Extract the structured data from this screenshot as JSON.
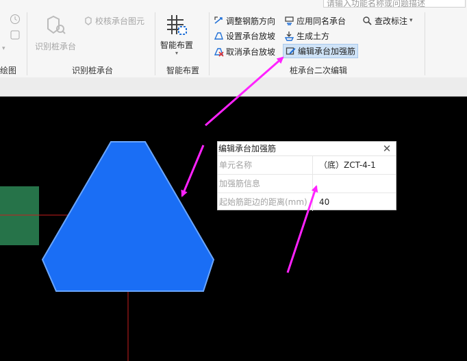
{
  "search": {
    "placeholder": "请输入功能名称或问题描述"
  },
  "ribbon": {
    "left_group_label": "绘图",
    "recognize_group": {
      "label": "识别桩承台",
      "recognize_button": "识别桩承台",
      "check_button": "校核承台图元"
    },
    "smart_group": {
      "label": "智能布置",
      "button": "智能布置"
    },
    "edit_group": {
      "label": "桩承台二次编辑",
      "commands": {
        "adjust_rebar": "调整钢筋方向",
        "apply_same": "应用同名承台",
        "modify_label": "查改标注",
        "set_slope": "设置承台放坡",
        "gen_earth": "生成土方",
        "cancel_slope": "取消承台放坡",
        "edit_reinforce": "编辑承台加强筋"
      }
    }
  },
  "dialog": {
    "title": "编辑承台加强筋",
    "rows": [
      {
        "key": "单元名称",
        "value": "（底）ZCT-4-1"
      },
      {
        "key": "加强筋信息",
        "value": ""
      },
      {
        "key": "起始筋距边的距离(mm)",
        "value": "40"
      }
    ]
  },
  "colors": {
    "shape_fill": "#1a6ef5",
    "shape_stroke": "#6aa6ff",
    "green_block": "#267349",
    "red_line": "#c81e1e",
    "arrow": "#ff22ff",
    "active_bg": "#cfe3f7"
  }
}
